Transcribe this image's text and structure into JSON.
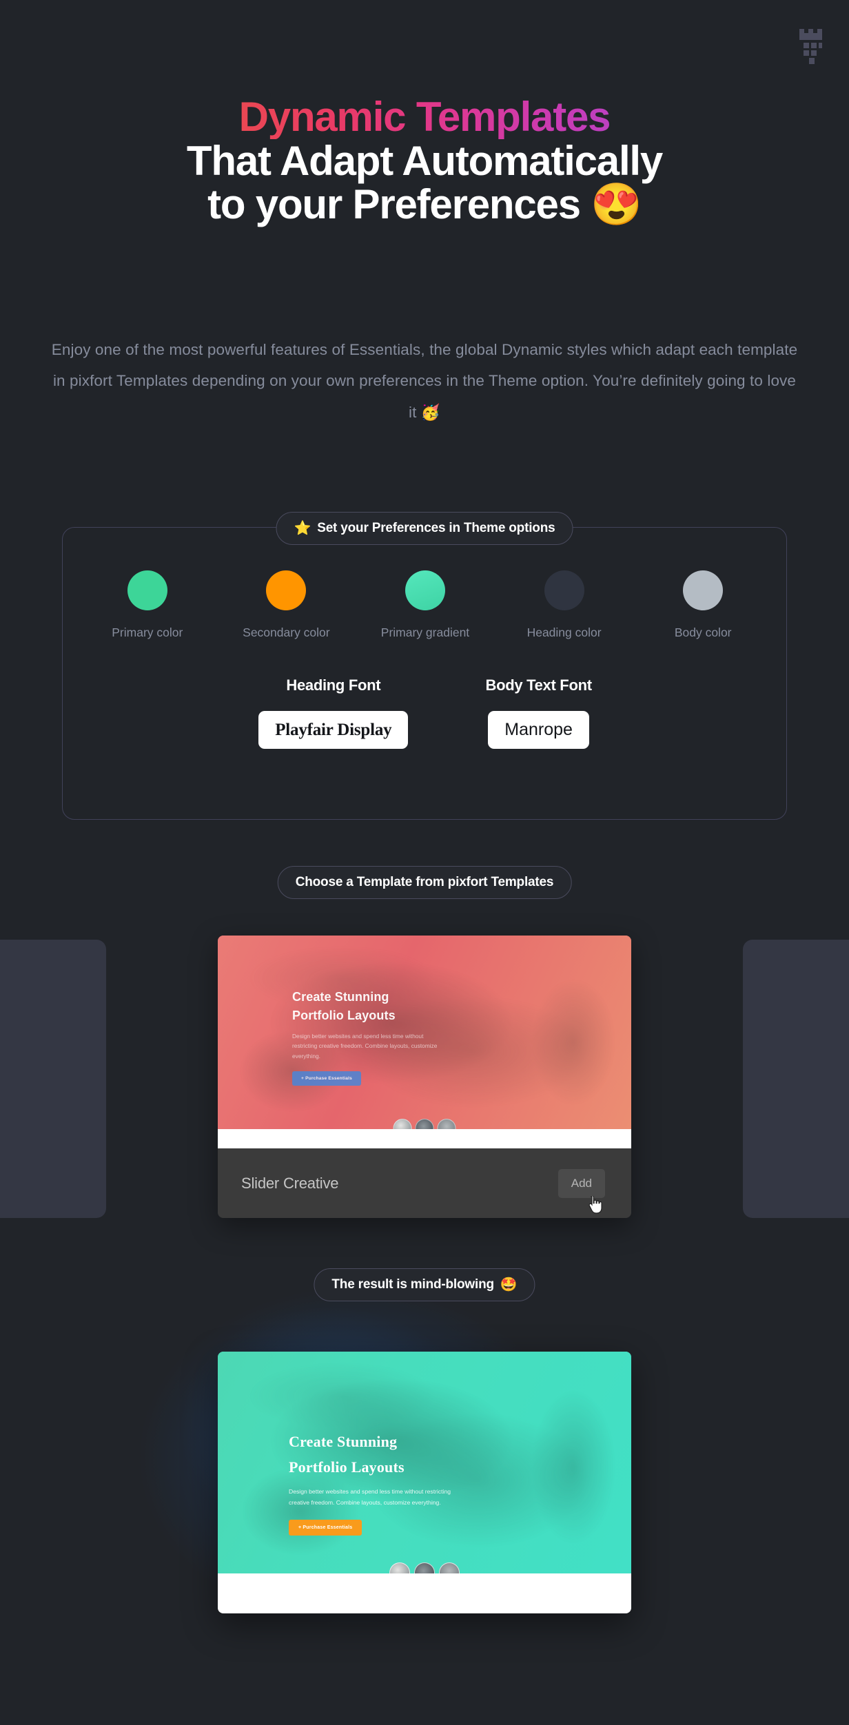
{
  "brand": {
    "icon": "pixfort-fort-logo",
    "color": "#4B4C5E"
  },
  "hero": {
    "gradient_line": "Dynamic Templates",
    "line2": "That Adapt Automatically",
    "line3": "to your Preferences",
    "line3_emoji": "😍",
    "gradient_from": "#F5873F",
    "gradient_to": "#9451E8",
    "paragraph": "Enjoy one of the most powerful features of Essentials, the global Dynamic styles which adapt each template in pixfort Templates depending on your own preferences in the Theme option. You’re definitely going to love it 🥳"
  },
  "preferences": {
    "badge_emoji": "⭐",
    "badge_label": "Set your Preferences in Theme options",
    "swatches": [
      {
        "label": "Primary color",
        "color": "#3DD598",
        "name": "primary-color"
      },
      {
        "label": "Secondary color",
        "color": "#FF9500",
        "name": "secondary-color"
      },
      {
        "label": "Primary gradient",
        "color": "#4BE0B0",
        "name": "primary-gradient"
      },
      {
        "label": "Heading color",
        "color": "#2F3440",
        "name": "heading-color"
      },
      {
        "label": "Body color",
        "color": "#B4BCC4",
        "name": "body-color"
      }
    ],
    "fonts": [
      {
        "title": "Heading Font",
        "value": "Playfair Display"
      },
      {
        "title": "Body Text Font",
        "value": "Manrope"
      }
    ]
  },
  "templates": {
    "badge_label": "Choose a Template from pixfort Templates",
    "card": {
      "heading_line1": "Create Stunning",
      "heading_line2": "Portfolio Layouts",
      "paragraph": "Design better websites and spend less time without restricting creative freedom. Combine layouts, customize everything.",
      "cta_label": "+ Purchase Essentials",
      "cta_color": "#4A86D8",
      "title": "Slider Creative",
      "add_label": "Add",
      "cursor_icon": "pointer-hand-cursor"
    }
  },
  "result": {
    "badge_label": "The result is mind-blowing",
    "badge_emoji": "🤩",
    "card": {
      "heading_line1": "Create Stunning",
      "heading_line2": "Portfolio Layouts",
      "paragraph": "Design better websites and spend less time without restricting creative freedom. Combine layouts, customize everything.",
      "cta_label": "+ Purchase Essentials",
      "cta_color": "#F99B1C"
    },
    "glow_color": "#205696"
  }
}
